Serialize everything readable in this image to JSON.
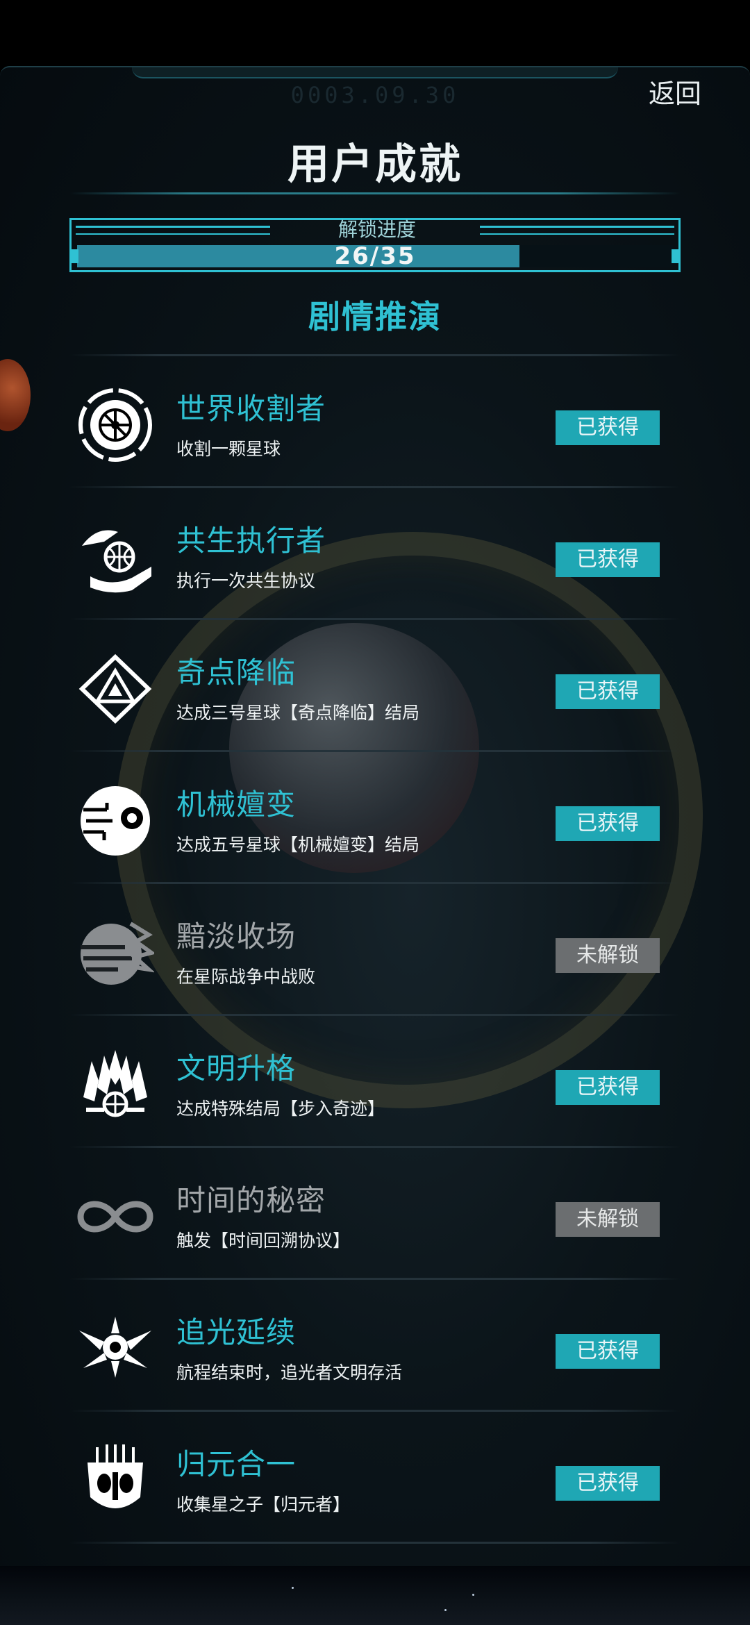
{
  "header": {
    "date": "0003.09.30",
    "back_label": "返回",
    "title": "用户成就"
  },
  "progress": {
    "label": "解锁进度",
    "text": "26/35",
    "current": 26,
    "total": 35,
    "fraction": 0.743
  },
  "section": {
    "title": "剧情推演"
  },
  "colors": {
    "accent": "#2fc1d3",
    "earned": "#1fa7b4",
    "locked": "#6b6e70"
  },
  "achievements": [
    {
      "title": "世界收割者",
      "desc": "收割一颗星球",
      "status": "已获得",
      "icon": "harvest-world-icon"
    },
    {
      "title": "共生执行者",
      "desc": "执行一次共生协议",
      "status": "已获得",
      "icon": "symbiosis-hand-globe-icon"
    },
    {
      "title": "奇点降临",
      "desc": "达成三号星球【奇点降临】结局",
      "status": "已获得",
      "icon": "singularity-triangle-icon"
    },
    {
      "title": "机械嬗变",
      "desc": "达成五号星球【机械嬗变】结局",
      "status": "已获得",
      "icon": "mechanical-eye-icon"
    },
    {
      "title": "黯淡收场",
      "desc": "在星际战争中战败",
      "status": "未解锁",
      "icon": "shattered-planet-icon"
    },
    {
      "title": "文明升格",
      "desc": "达成特殊结局【步入奇迹】",
      "status": "已获得",
      "icon": "winged-emblem-icon"
    },
    {
      "title": "时间的秘密",
      "desc": "触发【时间回溯协议】",
      "status": "未解锁",
      "icon": "infinity-icon"
    },
    {
      "title": "追光延续",
      "desc": "航程结束时，追光者文明存活",
      "status": "已获得",
      "icon": "winged-star-icon"
    },
    {
      "title": "归元合一",
      "desc": "收集星之子【归元者】",
      "status": "已获得",
      "icon": "mask-circuit-icon"
    }
  ]
}
